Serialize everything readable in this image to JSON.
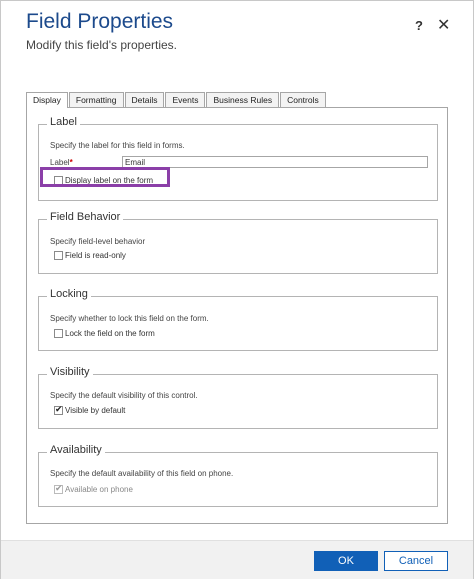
{
  "dialog": {
    "title": "Field Properties",
    "subtitle": "Modify this field's properties.",
    "help_label": "?",
    "close_label": "✕"
  },
  "tabs": [
    {
      "label": "Display",
      "active": true
    },
    {
      "label": "Formatting"
    },
    {
      "label": "Details"
    },
    {
      "label": "Events"
    },
    {
      "label": "Business Rules"
    },
    {
      "label": "Controls"
    }
  ],
  "label_group": {
    "legend": "Label",
    "description": "Specify the label for this field in forms.",
    "field_label": "Label",
    "required_marker": "*",
    "value": "Email",
    "checkbox_label": "Display label on the form",
    "checkbox_checked": false
  },
  "behavior_group": {
    "legend": "Field Behavior",
    "description": "Specify field-level behavior",
    "checkbox_label": "Field is read-only",
    "checkbox_checked": false
  },
  "locking_group": {
    "legend": "Locking",
    "description": "Specify whether to lock this field on the form.",
    "checkbox_label": "Lock the field on the form",
    "checkbox_checked": false
  },
  "visibility_group": {
    "legend": "Visibility",
    "description": "Specify the default visibility of this control.",
    "checkbox_label": "Visible by default",
    "checkbox_checked": true
  },
  "availability_group": {
    "legend": "Availability",
    "description": "Specify the default availability of this field on phone.",
    "checkbox_label": "Available on phone",
    "checkbox_checked": true,
    "disabled": true
  },
  "footer": {
    "ok_label": "OK",
    "cancel_label": "Cancel"
  },
  "colors": {
    "title": "#1c4a8c",
    "primary_button": "#1160b7",
    "highlight": "#8b3fa8"
  }
}
